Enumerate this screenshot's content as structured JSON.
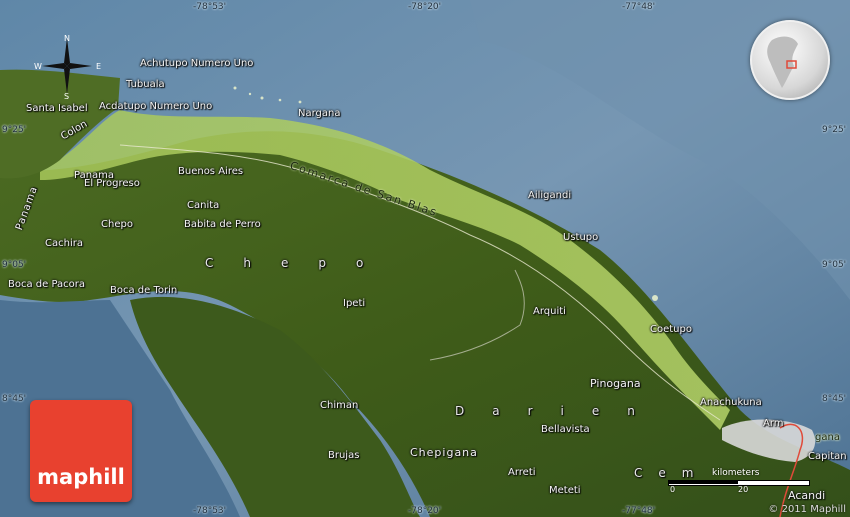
{
  "brand": {
    "logo_text": "maphill",
    "copyright": "© 2011 Maphill",
    "color": "#e8412f"
  },
  "coordinates": {
    "top": [
      "-78°53'",
      "-78°20'",
      "-77°48'"
    ],
    "bottom": [
      "-78°53'",
      "-78°20'",
      "-77°48'"
    ],
    "left": [
      "9°25'",
      "9°05'",
      "8°45'"
    ],
    "right": [
      "9°25'",
      "9°05'",
      "8°45'"
    ]
  },
  "compass": {
    "n": "N",
    "s": "S",
    "e": "E",
    "w": "W"
  },
  "scale": {
    "unit": "kilometers",
    "left_value": "0",
    "right_value": "20"
  },
  "places": {
    "achutupo": "Achutupo Numero Uno",
    "tubuala": "Tubuala",
    "acdatupo": "Acdatupo Numero Uno",
    "santa_isabel": "Santa Isabel",
    "colon": "Colon",
    "nargana": "Nargana",
    "san_blas": "Comarca de San Blas",
    "panama_region": "Panama",
    "panama_city": "Panama",
    "el_progreso": "El Progreso",
    "buenos_aires": "Buenos Aires",
    "ailigandi": "Ailigandi",
    "chepo_town": "Chepo",
    "canita": "Canita",
    "babita": "Babita de Perro",
    "ustupo": "Ustupo",
    "cachira": "Cachira",
    "chepo_region": "Chepo",
    "boca_pacora": "Boca de Pacora",
    "boca_torin": "Boca de Torin",
    "ipeti": "Ipeti",
    "arquiti": "Arquiti",
    "coetupo": "Coetupo",
    "pinogana": "Pinogana",
    "anachukuna": "Anachukuna",
    "chiman": "Chiman",
    "darien": "Darien",
    "bellavista": "Bellavista",
    "arm": "Arm",
    "gana": "gana",
    "capitan": "Capitan",
    "brujas": "Brujas",
    "chepigana": "Chepigana",
    "arreti": "Arreti",
    "cem": "Cem",
    "meteti": "Meteti",
    "acandi": "Acandi"
  }
}
